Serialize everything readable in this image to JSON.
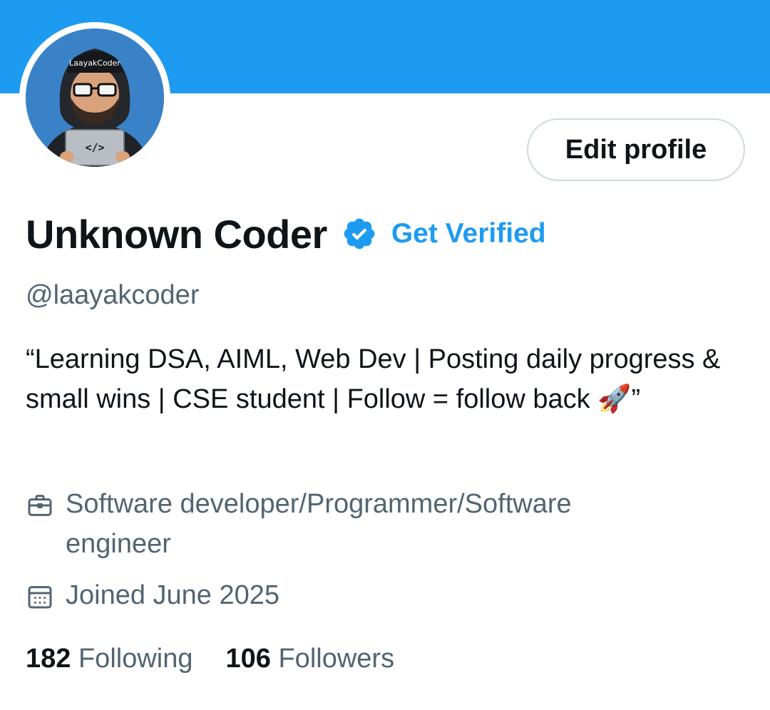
{
  "profile": {
    "display_name": "Unknown Coder",
    "get_verified_label": "Get Verified",
    "handle": "@laayakcoder",
    "bio": "“Learning DSA, AIML, Web Dev | Posting daily progress & small wins | CSE student | Follow = follow back 🚀”",
    "profession": "Software developer/Programmer/Software engineer",
    "joined": "Joined June 2025",
    "avatar_cap_text": "LaayakCoder",
    "avatar_laptop_text": "</>"
  },
  "actions": {
    "edit_profile_label": "Edit profile"
  },
  "stats": {
    "following_count": "182",
    "following_label": "Following",
    "followers_count": "106",
    "followers_label": "Followers"
  },
  "icons": {
    "verified": "verified-badge-icon",
    "profession": "briefcase-icon",
    "joined": "calendar-icon"
  },
  "colors": {
    "banner": "#1d9bf0",
    "accent": "#1d9bf0",
    "primary_text": "#0f1419",
    "secondary_text": "#536471",
    "button_border": "#cfd9de"
  }
}
